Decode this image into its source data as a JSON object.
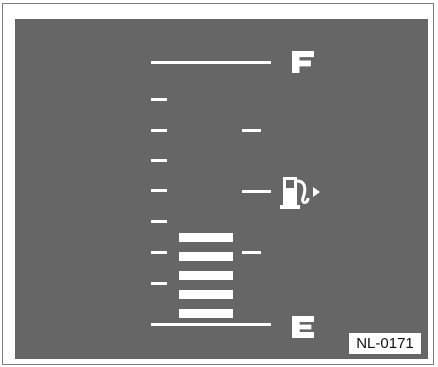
{
  "gauge": {
    "full_label": "F",
    "empty_label": "E",
    "image_code": "NL-0171",
    "fuel_level_segments": 5,
    "fuel_warning_icon": "fuel-pump-icon",
    "colors": {
      "panel": "#666667",
      "marks": "#ffffff",
      "frame": "#7d7d7d",
      "text": "#111111"
    }
  }
}
